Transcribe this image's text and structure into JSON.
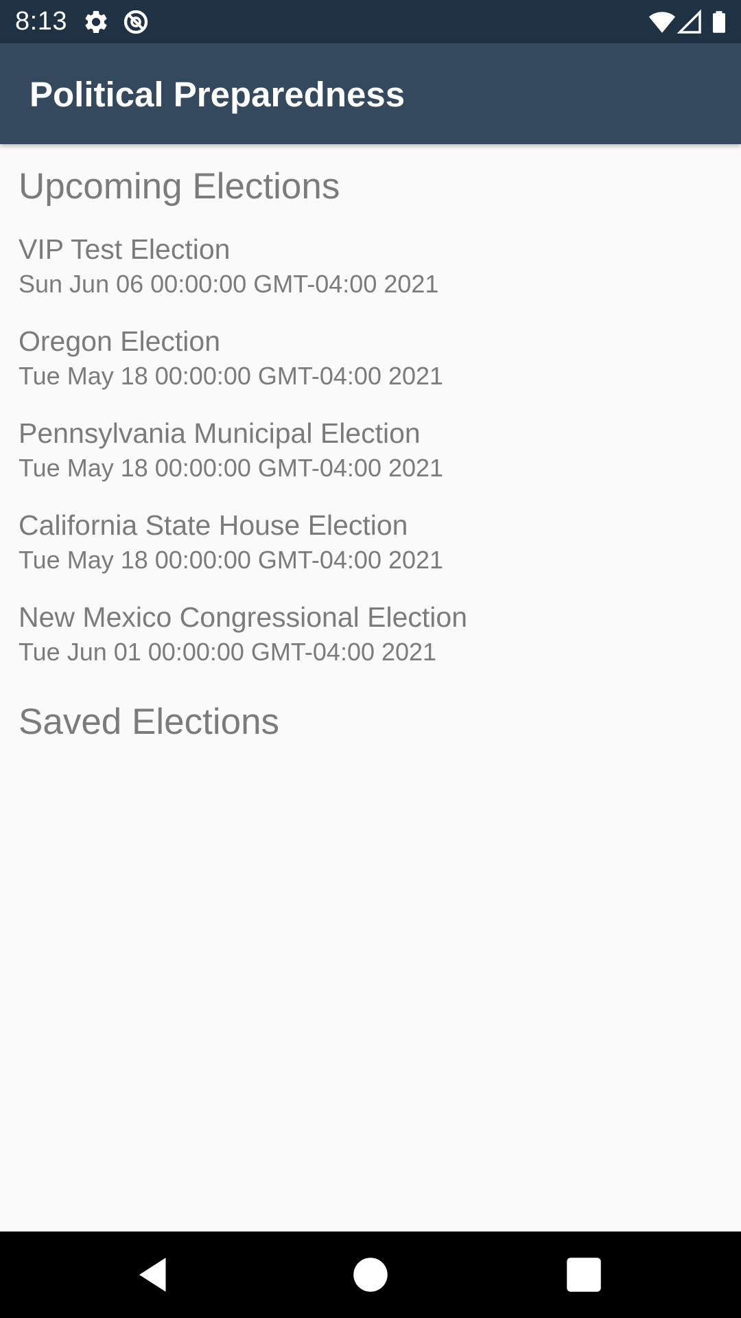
{
  "status_bar": {
    "time": "8:13",
    "icons": [
      "gear-icon",
      "sync-disabled-icon",
      "wifi-icon",
      "signal-icon",
      "battery-icon"
    ]
  },
  "app_bar": {
    "title": "Political Preparedness"
  },
  "upcoming": {
    "header": "Upcoming Elections",
    "items": [
      {
        "name": "VIP Test Election",
        "date": "Sun Jun 06 00:00:00 GMT-04:00 2021"
      },
      {
        "name": "Oregon Election",
        "date": "Tue May 18 00:00:00 GMT-04:00 2021"
      },
      {
        "name": "Pennsylvania Municipal Election",
        "date": "Tue May 18 00:00:00 GMT-04:00 2021"
      },
      {
        "name": "California State House Election",
        "date": "Tue May 18 00:00:00 GMT-04:00 2021"
      },
      {
        "name": "New Mexico Congressional Election",
        "date": "Tue Jun 01 00:00:00 GMT-04:00 2021"
      }
    ]
  },
  "saved": {
    "header": "Saved Elections",
    "items": []
  },
  "nav_bar": {
    "buttons": [
      "back-icon",
      "home-icon",
      "recents-icon"
    ]
  },
  "colors": {
    "status_bar": "#1f3244",
    "app_bar": "#34495e",
    "background": "#fafafa",
    "text": "#7b7b7b"
  }
}
